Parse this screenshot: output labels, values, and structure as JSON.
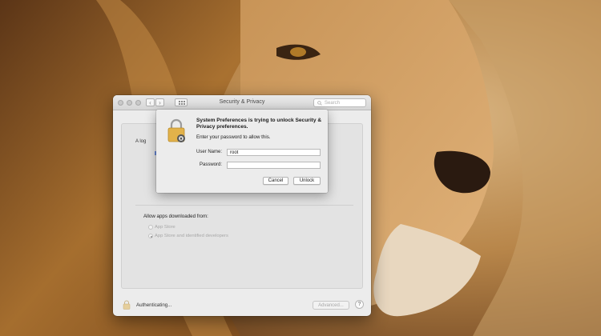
{
  "window": {
    "title": "Security & Privacy",
    "search_placeholder": "Search",
    "nav_back": "‹",
    "nav_forward": "›"
  },
  "panel": {
    "partial_text": "A log",
    "allow_label": "Allow apps downloaded from:",
    "options": [
      {
        "label": "App Store",
        "selected": false
      },
      {
        "label": "App Store and identified developers",
        "selected": true
      }
    ]
  },
  "footer": {
    "status": "Authenticating...",
    "advanced_label": "Advanced...",
    "help_label": "?"
  },
  "dialog": {
    "title": "System Preferences is trying to unlock Security & Privacy preferences.",
    "message": "Enter your password to allow this.",
    "username_label": "User Name:",
    "username_value": "root",
    "password_label": "Password:",
    "password_value": "",
    "cancel_label": "Cancel",
    "unlock_label": "Unlock"
  },
  "icons": {
    "lock": "lock-icon",
    "search": "search-icon",
    "grid": "grid-icon"
  },
  "colors": {
    "lock_body": "#e2b24a",
    "wallpaper_base": "#b07a3c"
  }
}
